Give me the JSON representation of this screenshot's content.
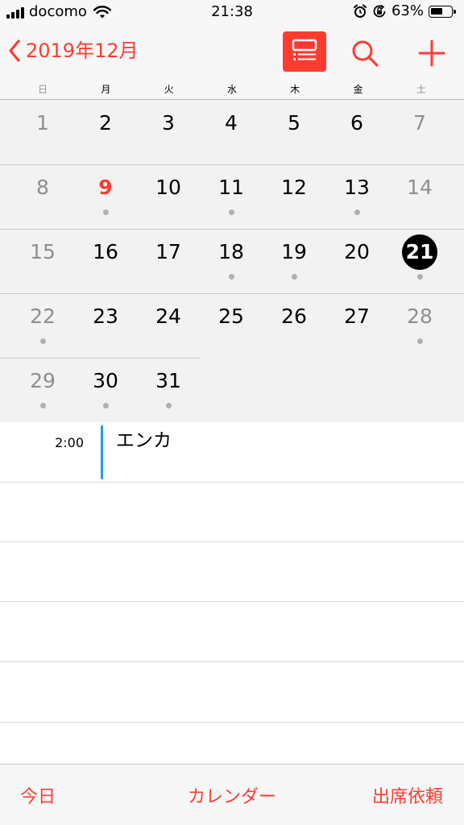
{
  "status_bar": {
    "carrier": "docomo",
    "time": "21:38",
    "battery_percent": "63%",
    "battery_level": 0.63,
    "icons": [
      "signal-icon",
      "wifi-icon",
      "alarm-icon",
      "orientation-lock-icon",
      "battery-icon"
    ]
  },
  "nav": {
    "back_label": "2019年12月",
    "buttons": [
      "list-view-icon",
      "search-icon",
      "plus-icon"
    ]
  },
  "weekdays": [
    "日",
    "月",
    "火",
    "水",
    "木",
    "金",
    "土"
  ],
  "calendar": {
    "weeks": [
      [
        {
          "d": "1"
        },
        {
          "d": "2"
        },
        {
          "d": "3"
        },
        {
          "d": "4"
        },
        {
          "d": "5"
        },
        {
          "d": "6"
        },
        {
          "d": "7"
        }
      ],
      [
        {
          "d": "8"
        },
        {
          "d": "9",
          "holiday": true,
          "dot": true
        },
        {
          "d": "10"
        },
        {
          "d": "11",
          "dot": true
        },
        {
          "d": "12"
        },
        {
          "d": "13",
          "dot": true
        },
        {
          "d": "14"
        }
      ],
      [
        {
          "d": "15"
        },
        {
          "d": "16"
        },
        {
          "d": "17"
        },
        {
          "d": "18",
          "dot": true
        },
        {
          "d": "19",
          "dot": true
        },
        {
          "d": "20"
        },
        {
          "d": "21",
          "today": true,
          "dot": true
        }
      ],
      [
        {
          "d": "22",
          "dot": true
        },
        {
          "d": "23"
        },
        {
          "d": "24"
        },
        {
          "d": "25"
        },
        {
          "d": "26"
        },
        {
          "d": "27"
        },
        {
          "d": "28",
          "dot": true
        }
      ],
      [
        {
          "d": "29",
          "dot": true
        },
        {
          "d": "30",
          "dot": true
        },
        {
          "d": "31",
          "dot": true
        }
      ]
    ]
  },
  "events": [
    {
      "time": "2:00",
      "title": "エンカ",
      "color": "#1ea0e6"
    }
  ],
  "tabs": {
    "today": "今日",
    "calendars": "カレンダー",
    "inbox": "出席依頼"
  },
  "colors": {
    "accent": "#ff3b30",
    "weekend": "#8e8e93",
    "dot": "#b0b0b4",
    "today": "#000000"
  }
}
